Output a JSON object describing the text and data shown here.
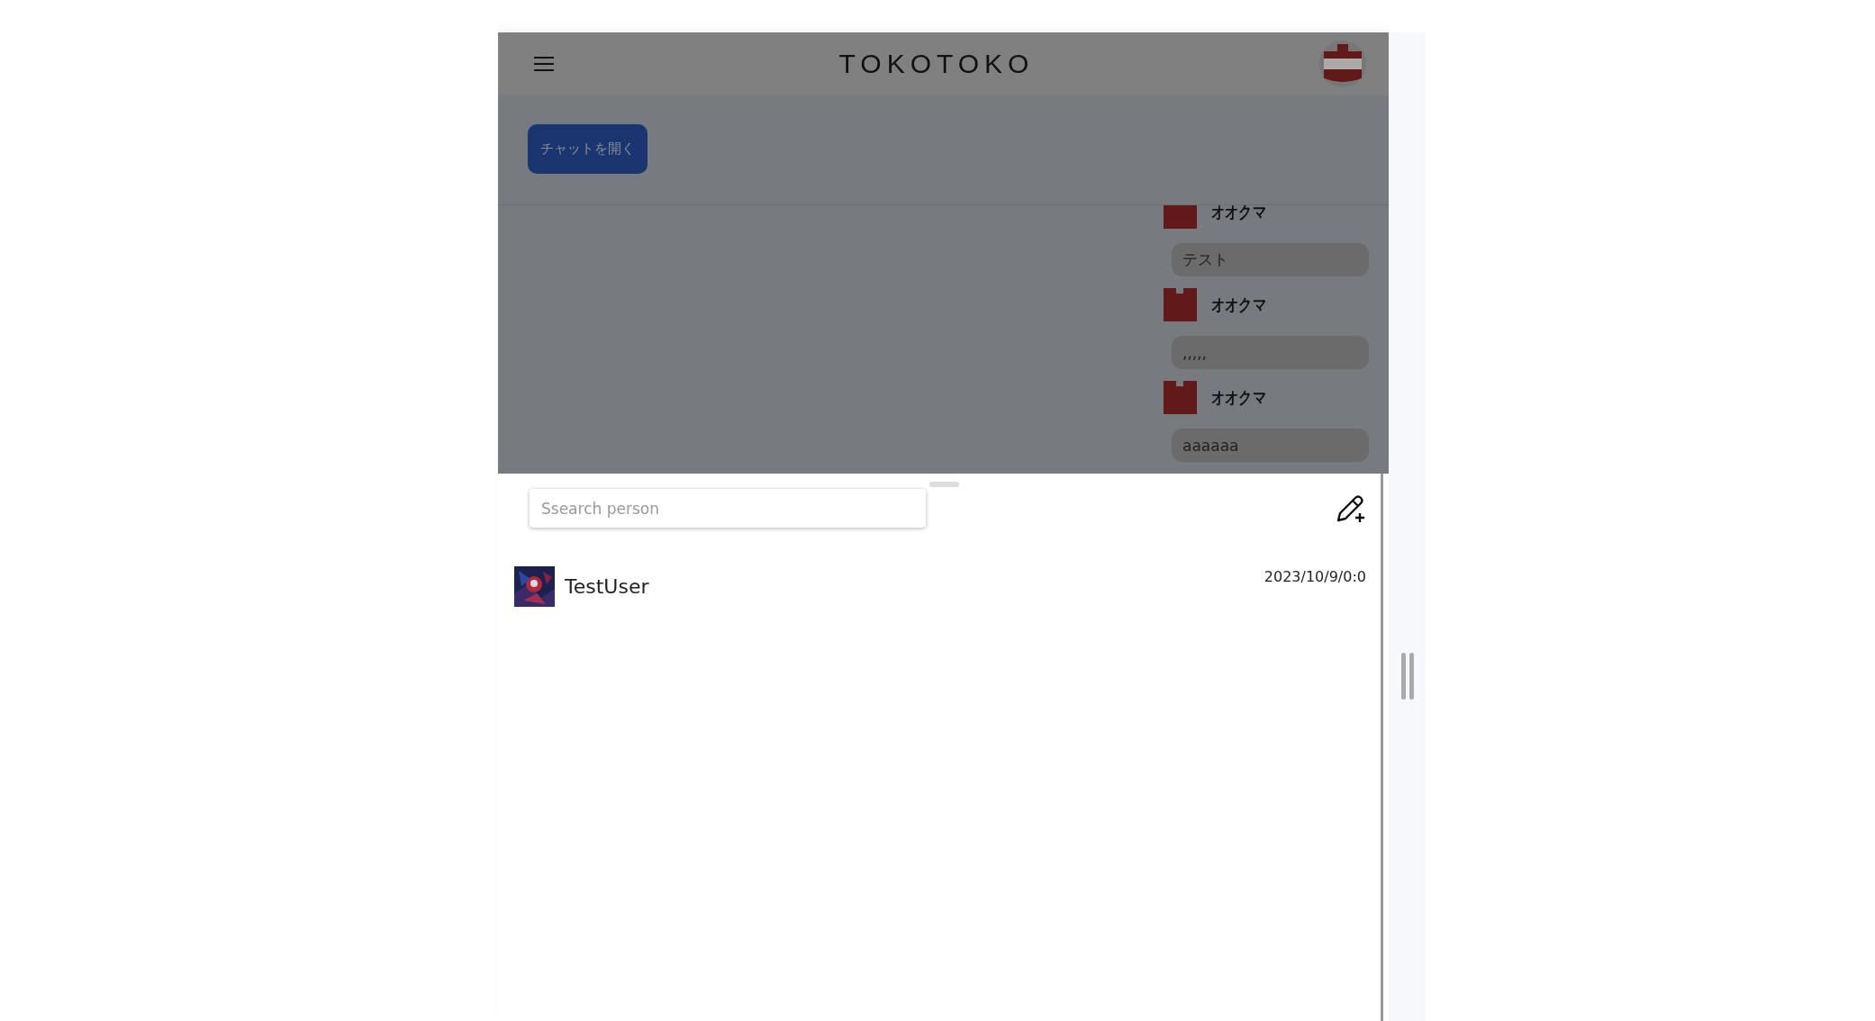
{
  "header": {
    "title": "TOKOTOKO"
  },
  "open_chat_button": {
    "label": "チャットを開く"
  },
  "messages": [
    {
      "author": "オオクマ",
      "text": "テスト"
    },
    {
      "author": "オオクマ",
      "text": ",,,,,"
    },
    {
      "author": "オオクマ",
      "text": "aaaaaa"
    }
  ],
  "search": {
    "placeholder": "Ssearch person"
  },
  "conversations": [
    {
      "name": "TestUser",
      "date": "2023/10/9/0:0"
    }
  ]
}
